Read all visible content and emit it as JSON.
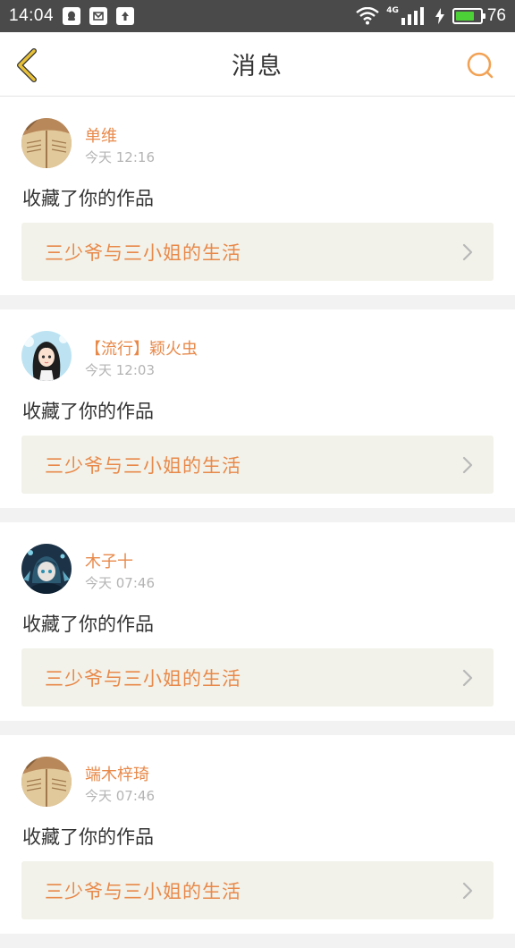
{
  "status_bar": {
    "time": "14:04",
    "network": "4G",
    "battery_level": "76",
    "battery_fraction": 0.76,
    "icons": [
      "qq-icon",
      "mail-icon",
      "upload-icon",
      "wifi-icon",
      "signal-icon",
      "charging-icon",
      "battery-icon"
    ]
  },
  "header": {
    "title": "消息",
    "back_icon": "chevron-left-icon",
    "search_icon": "search-icon",
    "accent_color": "#f2a255"
  },
  "colors": {
    "accent": "#e8894a",
    "back_arrow": "#e8c23a",
    "work_bg": "#f2f2ea"
  },
  "messages": [
    {
      "user": "单维",
      "time": "今天 12:16",
      "action": "收藏了你的作品",
      "work": "三少爷与三小姐的生活",
      "avatar": "book-avatar"
    },
    {
      "user": "【流行】颖火虫",
      "time": "今天 12:03",
      "action": "收藏了你的作品",
      "work": "三少爷与三小姐的生活",
      "avatar": "girl-avatar"
    },
    {
      "user": "木子十",
      "time": "今天 07:46",
      "action": "收藏了你的作品",
      "work": "三少爷与三小姐的生活",
      "avatar": "anime-avatar"
    },
    {
      "user": "端木梓琦",
      "time": "今天 07:46",
      "action": "收藏了你的作品",
      "work": "三少爷与三小姐的生活",
      "avatar": "book-avatar"
    }
  ]
}
